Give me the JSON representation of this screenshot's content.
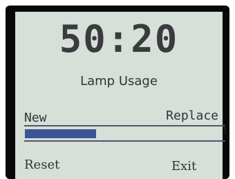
{
  "display": {
    "time": "50:20",
    "caption": "Lamp Usage"
  },
  "gauge": {
    "left_label": "New",
    "right_label": "Replace",
    "warning_mark": "!",
    "fill_fraction": 0.38,
    "fill_color": "#3b5596"
  },
  "softkeys": {
    "left": "Reset",
    "right": "Exit"
  },
  "colors": {
    "screen_bg": "#d6dfd8",
    "bezel": "#080808"
  }
}
